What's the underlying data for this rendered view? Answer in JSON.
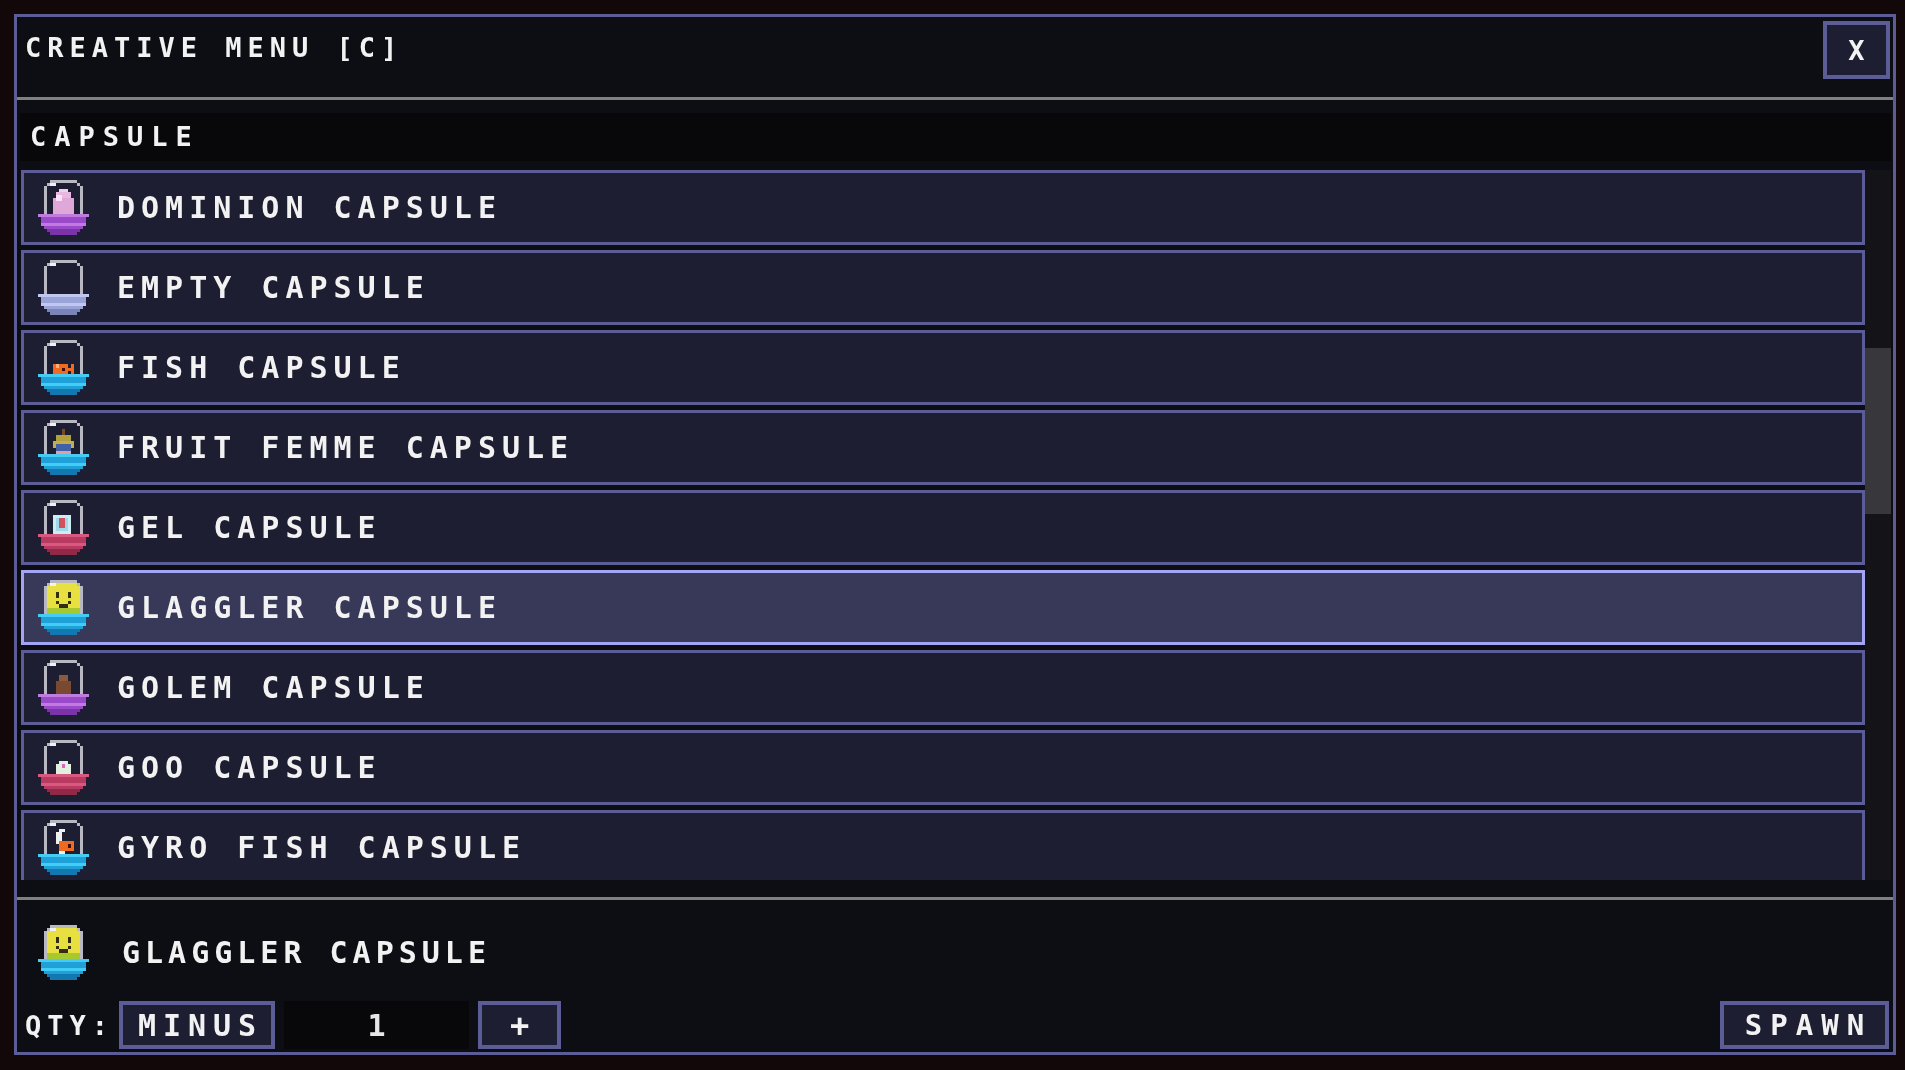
{
  "window": {
    "title": "CREATIVE MENU [C]",
    "close": {
      "label": "X"
    }
  },
  "category": {
    "label": "CAPSULE"
  },
  "items": [
    {
      "label": "DOMINION CAPSULE",
      "kind": "dominion",
      "selected": false
    },
    {
      "label": "EMPTY CAPSULE",
      "kind": "empty",
      "selected": false
    },
    {
      "label": "FISH CAPSULE",
      "kind": "fish",
      "selected": false
    },
    {
      "label": "FRUIT FEMME CAPSULE",
      "kind": "fruit",
      "selected": false
    },
    {
      "label": "GEL CAPSULE",
      "kind": "gel",
      "selected": false
    },
    {
      "label": "GLAGGLER CAPSULE",
      "kind": "glaggler",
      "selected": true
    },
    {
      "label": "GOLEM CAPSULE",
      "kind": "golem",
      "selected": false
    },
    {
      "label": "GOO CAPSULE",
      "kind": "goo",
      "selected": false
    },
    {
      "label": "GYRO FISH CAPSULE",
      "kind": "gyrofish",
      "selected": false
    }
  ],
  "preview": {
    "label": "GLAGGLER CAPSULE",
    "kind": "glaggler"
  },
  "quantity": {
    "label": "QTY:",
    "minus": "MINUS",
    "value": "1",
    "plus": "+"
  },
  "spawn": {
    "label": "SPAWN"
  }
}
